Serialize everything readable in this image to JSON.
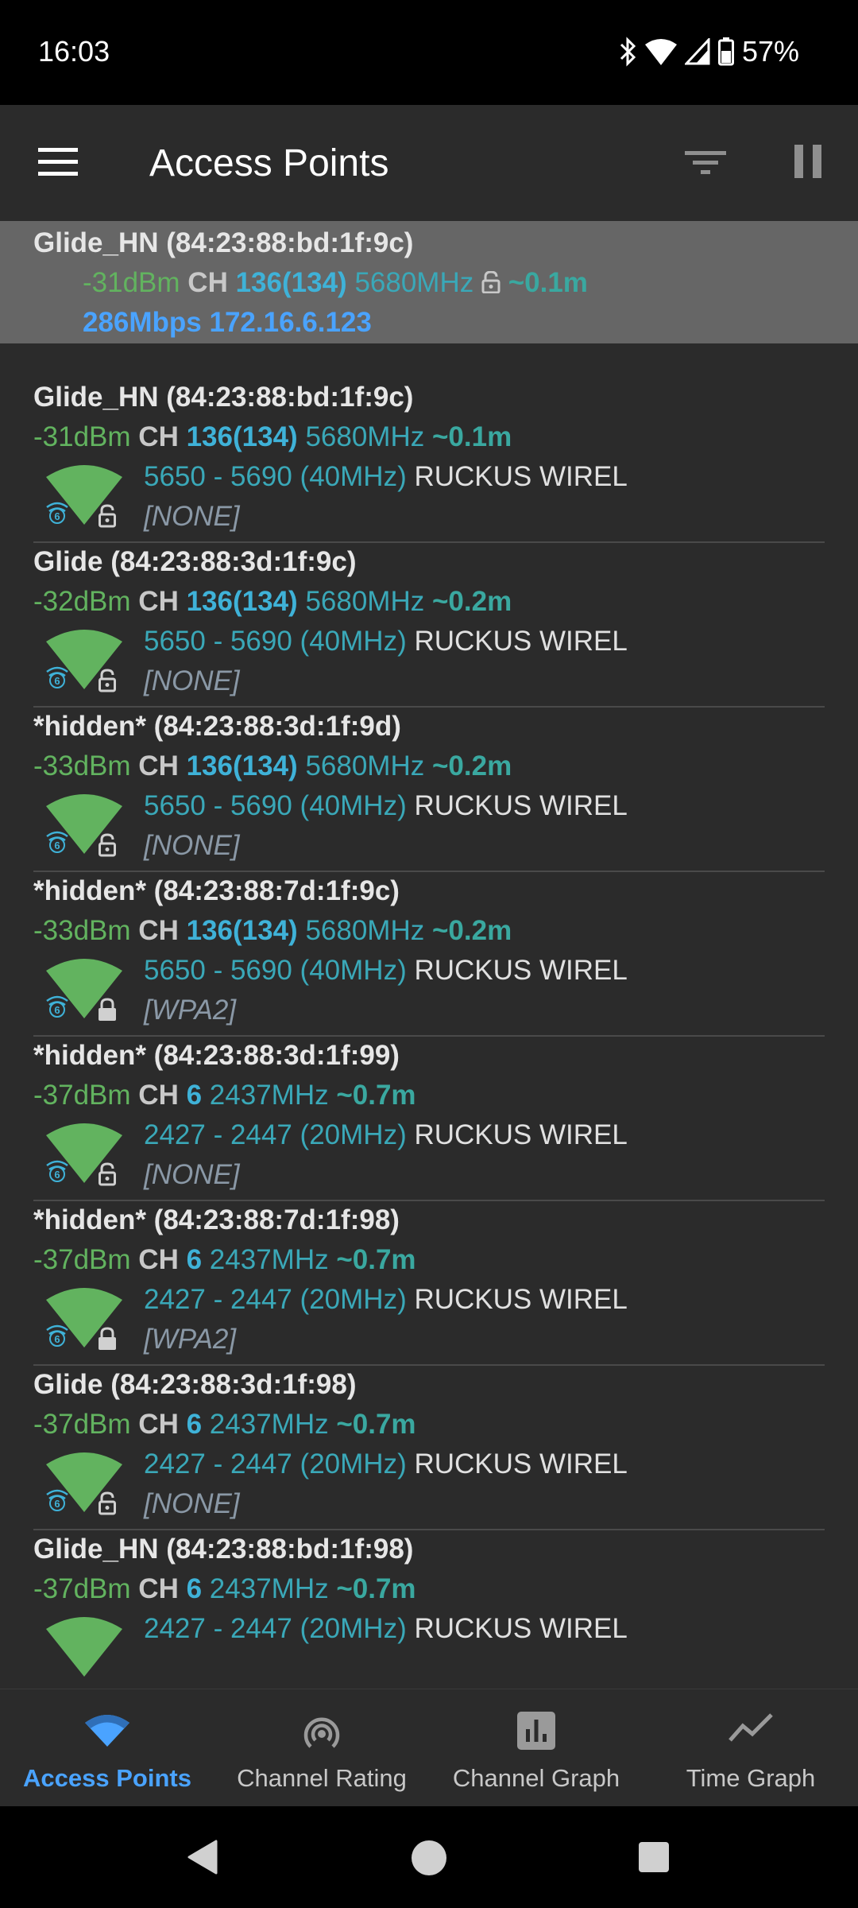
{
  "status": {
    "time": "16:03",
    "battery": "57%"
  },
  "app_bar": {
    "title": "Access Points"
  },
  "connected": {
    "title": "Glide_HN (84:23:88:bd:1f:9c)",
    "dbm": "-31dBm",
    "ch_label": "CH",
    "channel": "136(134)",
    "freq": "5680MHz",
    "distance": "~0.1m",
    "link": "286Mbps 172.16.6.123"
  },
  "access_points": [
    {
      "title": "Glide_HN (84:23:88:bd:1f:9c)",
      "dbm": "-31dBm",
      "ch_label": "CH",
      "channel": "136(134)",
      "freq": "5680MHz",
      "distance": "~0.1m",
      "range": "5650 - 5690 (40MHz)",
      "vendor": "RUCKUS WIREL",
      "security": "[NONE]",
      "lock": "open-lock-icon"
    },
    {
      "title": "Glide (84:23:88:3d:1f:9c)",
      "dbm": "-32dBm",
      "ch_label": "CH",
      "channel": "136(134)",
      "freq": "5680MHz",
      "distance": "~0.2m",
      "range": "5650 - 5690 (40MHz)",
      "vendor": "RUCKUS WIREL",
      "security": "[NONE]",
      "lock": "open-lock-icon"
    },
    {
      "title": "*hidden* (84:23:88:3d:1f:9d)",
      "dbm": "-33dBm",
      "ch_label": "CH",
      "channel": "136(134)",
      "freq": "5680MHz",
      "distance": "~0.2m",
      "range": "5650 - 5690 (40MHz)",
      "vendor": "RUCKUS WIREL",
      "security": "[NONE]",
      "lock": "open-lock-icon"
    },
    {
      "title": "*hidden* (84:23:88:7d:1f:9c)",
      "dbm": "-33dBm",
      "ch_label": "CH",
      "channel": "136(134)",
      "freq": "5680MHz",
      "distance": "~0.2m",
      "range": "5650 - 5690 (40MHz)",
      "vendor": "RUCKUS WIREL",
      "security": "[WPA2]",
      "lock": "closed-lock-icon"
    },
    {
      "title": "*hidden* (84:23:88:3d:1f:99)",
      "dbm": "-37dBm",
      "ch_label": "CH",
      "channel": "6",
      "freq": "2437MHz",
      "distance": "~0.7m",
      "range": "2427 - 2447 (20MHz)",
      "vendor": "RUCKUS WIREL",
      "security": "[NONE]",
      "lock": "open-lock-icon"
    },
    {
      "title": "*hidden* (84:23:88:7d:1f:98)",
      "dbm": "-37dBm",
      "ch_label": "CH",
      "channel": "6",
      "freq": "2437MHz",
      "distance": "~0.7m",
      "range": "2427 - 2447 (20MHz)",
      "vendor": "RUCKUS WIREL",
      "security": "[WPA2]",
      "lock": "closed-lock-icon"
    },
    {
      "title": "Glide (84:23:88:3d:1f:98)",
      "dbm": "-37dBm",
      "ch_label": "CH",
      "channel": "6",
      "freq": "2437MHz",
      "distance": "~0.7m",
      "range": "2427 - 2447 (20MHz)",
      "vendor": "RUCKUS WIREL",
      "security": "[NONE]",
      "lock": "open-lock-icon"
    },
    {
      "title": "Glide_HN (84:23:88:bd:1f:98)",
      "dbm": "-37dBm",
      "ch_label": "CH",
      "channel": "6",
      "freq": "2437MHz",
      "distance": "~0.7m",
      "range": "2427 - 2447 (20MHz)",
      "vendor": "RUCKUS WIREL",
      "security": "",
      "lock": ""
    }
  ],
  "bottom_nav": [
    {
      "label": "Access Points",
      "icon": "wifi-icon",
      "active": true
    },
    {
      "label": "Channel Rating",
      "icon": "radar-icon",
      "active": false
    },
    {
      "label": "Channel Graph",
      "icon": "bar-chart-icon",
      "active": false
    },
    {
      "label": "Time Graph",
      "icon": "line-chart-icon",
      "active": false
    }
  ],
  "colors": {
    "signal_green": "#62b35f",
    "channel_blue": "#3fb2d8",
    "freq_teal": "#3aa8b8",
    "link_blue": "#4aa3ff",
    "background": "#2b2b2b"
  }
}
